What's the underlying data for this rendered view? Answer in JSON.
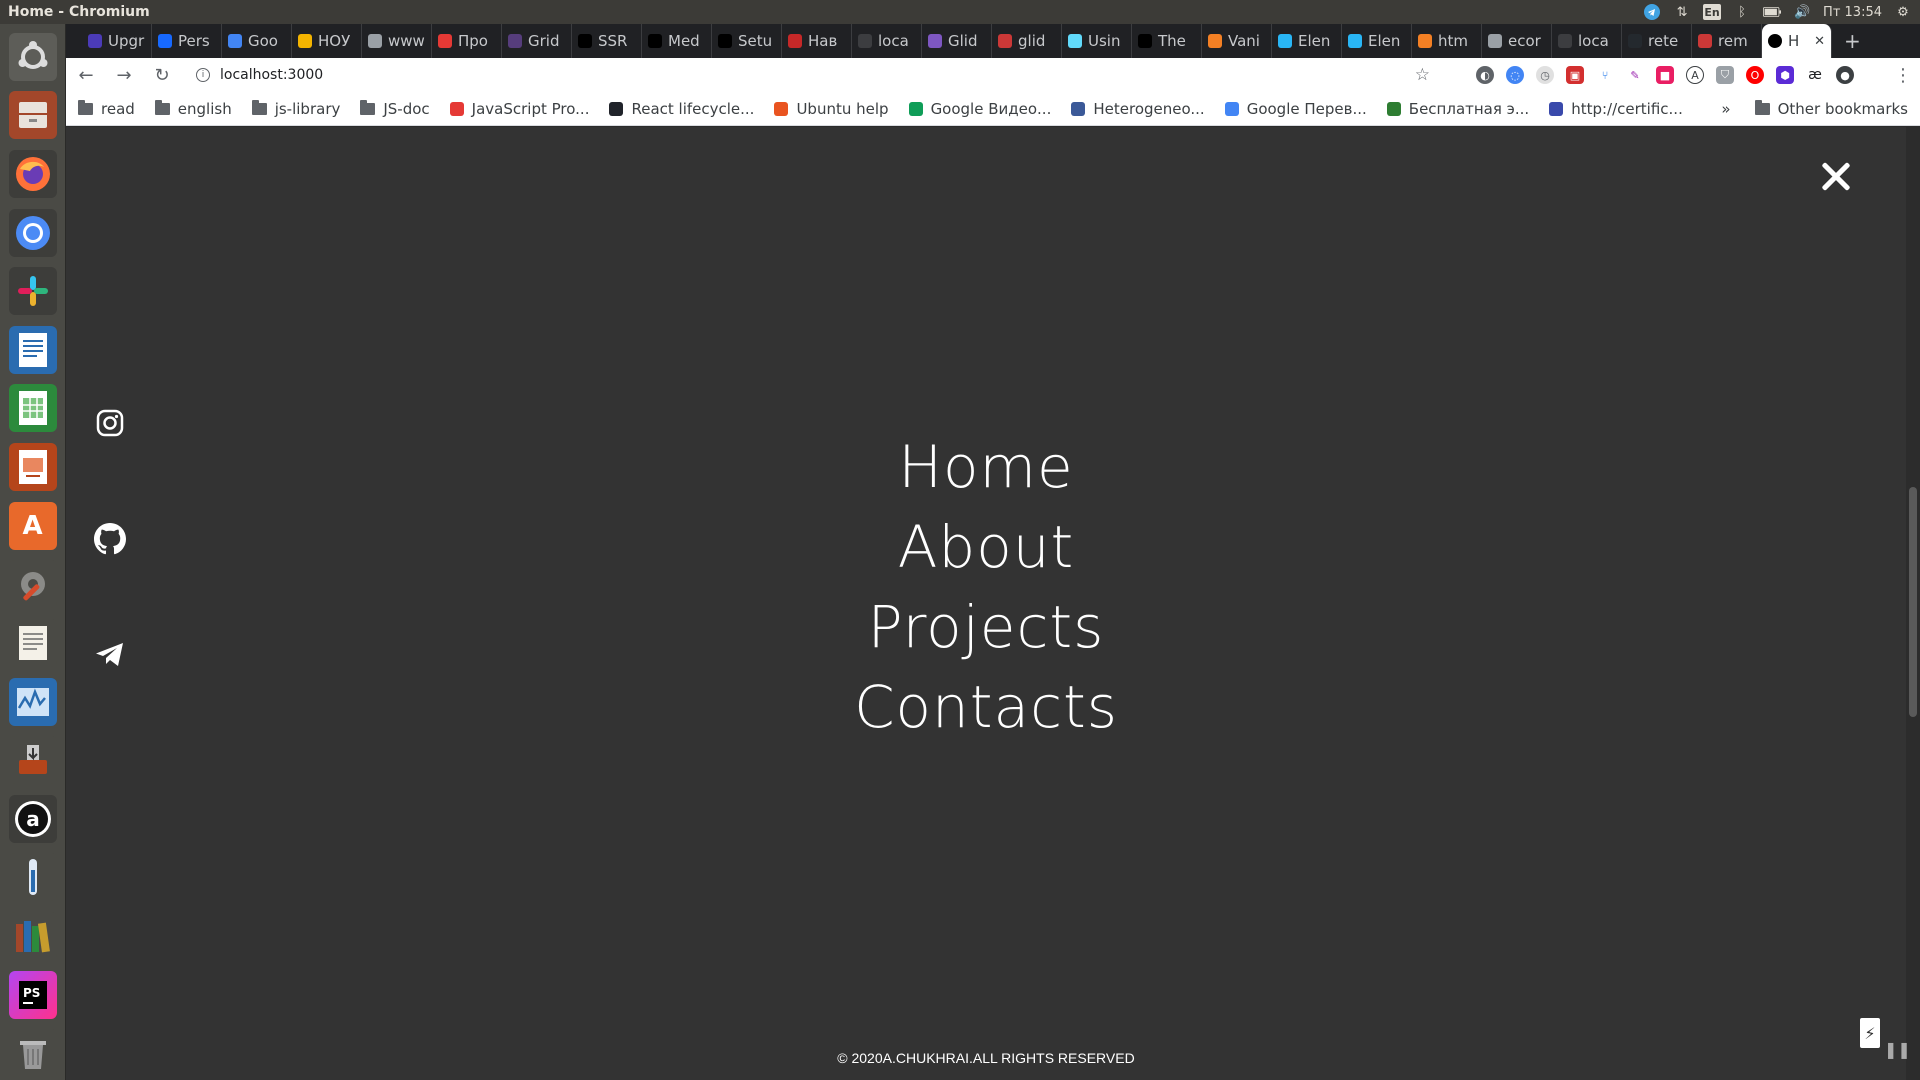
{
  "os": {
    "window_title": "Home - Chromium",
    "keyboard_layout": "En",
    "clock": "Пт 13:54"
  },
  "browser": {
    "tabs": [
      {
        "label": "Upgr",
        "color": "#4b3bb8"
      },
      {
        "label": "Pers",
        "color": "#1769ff"
      },
      {
        "label": "Goo",
        "color": "#4285f4"
      },
      {
        "label": "НОУ",
        "color": "#f4b400"
      },
      {
        "label": "www",
        "color": "#9aa0a6"
      },
      {
        "label": "Про",
        "color": "#e53935"
      },
      {
        "label": "Grid",
        "color": "#563d7c"
      },
      {
        "label": "SSR",
        "color": "#000000"
      },
      {
        "label": "Med",
        "color": "#000000"
      },
      {
        "label": "Setu",
        "color": "#000000"
      },
      {
        "label": "Нав",
        "color": "#c62828"
      },
      {
        "label": "loca",
        "color": "#3c3d40"
      },
      {
        "label": "Glid",
        "color": "#7e57c2"
      },
      {
        "label": "glid",
        "color": "#cb3837"
      },
      {
        "label": "Usin",
        "color": "#61dafb"
      },
      {
        "label": "The",
        "color": "#000000"
      },
      {
        "label": "Vani",
        "color": "#f48024"
      },
      {
        "label": "Elen",
        "color": "#29b6f6"
      },
      {
        "label": "Elen",
        "color": "#29b6f6"
      },
      {
        "label": "htm",
        "color": "#f48024"
      },
      {
        "label": "ecor",
        "color": "#9aa0a6"
      },
      {
        "label": "loca",
        "color": "#3c3d40"
      },
      {
        "label": "rete",
        "color": "#24292e"
      },
      {
        "label": "rem",
        "color": "#cb3837"
      }
    ],
    "active_tab": {
      "label": "H",
      "color": "#000000"
    },
    "url": "localhost:3000",
    "bookmarks": [
      {
        "label": "read",
        "type": "folder"
      },
      {
        "label": "english",
        "type": "folder"
      },
      {
        "label": "js-library",
        "type": "folder"
      },
      {
        "label": "JS-doc",
        "type": "folder"
      },
      {
        "label": "JavaScript Pro...",
        "type": "link",
        "color": "#e53935"
      },
      {
        "label": "React lifecycle...",
        "type": "link",
        "color": "#20232a"
      },
      {
        "label": "Ubuntu help",
        "type": "link",
        "color": "#e95420"
      },
      {
        "label": "Google Видео...",
        "type": "link",
        "color": "#0f9d58"
      },
      {
        "label": "Heterogeneo...",
        "type": "link",
        "color": "#3b5998"
      },
      {
        "label": "Google Перев...",
        "type": "link",
        "color": "#4285f4"
      },
      {
        "label": "Бесплатная э...",
        "type": "link",
        "color": "#2e7d32"
      },
      {
        "label": "http://certific...",
        "type": "link",
        "color": "#3949ab"
      }
    ],
    "bookmarks_overflow": "»",
    "other_bookmarks": "Other bookmarks"
  },
  "page": {
    "nav": [
      "Home",
      "About",
      "Projects",
      "Contacts"
    ],
    "footer": "© 2020A.CHUKHRAI.ALL RIGHTS RESERVED",
    "background": "#333333",
    "text_color": "#ffffff"
  }
}
